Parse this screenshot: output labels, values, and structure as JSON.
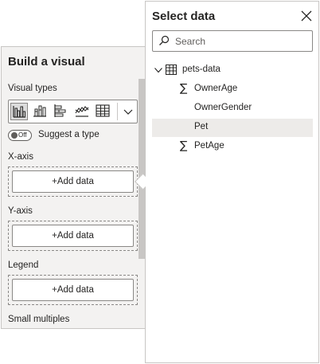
{
  "build_panel": {
    "title": "Build a visual",
    "visual_types_label": "Visual types",
    "visual_types": [
      {
        "icon": "clustered-column-chart-icon",
        "selected": true
      },
      {
        "icon": "column-chart-icon",
        "selected": false
      },
      {
        "icon": "stacked-bar-chart-icon",
        "selected": false
      },
      {
        "icon": "line-chart-icon",
        "selected": false
      },
      {
        "icon": "table-icon",
        "selected": false
      }
    ],
    "toggle_state": "Off",
    "suggest_label": "Suggest a type",
    "wells": [
      {
        "label": "X-axis",
        "button": "+Add data"
      },
      {
        "label": "Y-axis",
        "button": "+Add data"
      },
      {
        "label": "Legend",
        "button": "+Add data"
      }
    ],
    "small_multiples_label": "Small multiples"
  },
  "select_panel": {
    "title": "Select data",
    "search_placeholder": "Search",
    "tree": {
      "table_name": "pets-data",
      "fields": [
        {
          "name": "OwnerAge",
          "numeric": true,
          "highlighted": false
        },
        {
          "name": "OwnerGender",
          "numeric": false,
          "highlighted": false
        },
        {
          "name": "Pet",
          "numeric": false,
          "highlighted": true
        },
        {
          "name": "PetAge",
          "numeric": true,
          "highlighted": false
        }
      ]
    }
  },
  "colors": {
    "panel_bg": "#f3f2f1",
    "border": "#c8c6c4",
    "text": "#252423",
    "highlight": "#edebe9"
  }
}
